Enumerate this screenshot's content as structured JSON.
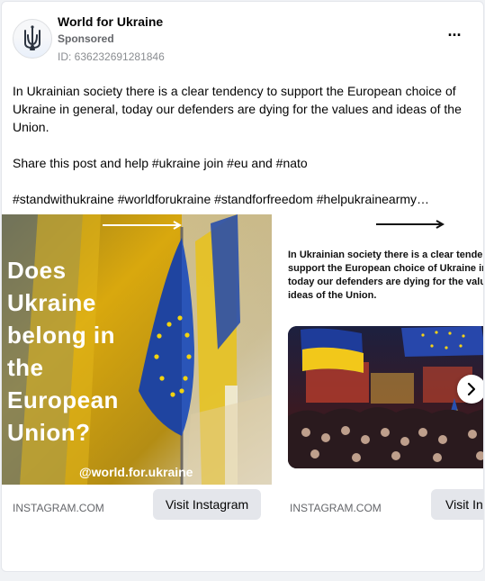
{
  "post": {
    "page_name": "World for Ukraine",
    "sponsored_label": "Sponsored",
    "ad_id": "ID: 636232691281846",
    "more_icon": "more-horizontal-icon",
    "text": {
      "paragraph1": "In Ukrainian society there is a clear tendency to support the European choice of Ukraine in general, today our defenders are dying for the values and ideas of the Union.",
      "paragraph2": "Share this post and help #ukraine join #eu and #nato",
      "paragraph3": "#standwithukraine #worldforukraine #standforfreedom #helpukrainearmy…"
    }
  },
  "carousel": {
    "cards": [
      {
        "image_headline": "Does\nUkraine\nbelong in\nthe\nEuropean\nUnion?",
        "image_handle": "@world.for.ukraine",
        "domain": "INSTAGRAM.COM",
        "button_label": "Visit Instagram"
      },
      {
        "image_text": "In Ukrainian society there is a clear tendency to\nsupport the European choice of Ukraine in general,\ntoday our defenders are dying for the values and\nideas of the Union.",
        "domain": "INSTAGRAM.COM",
        "button_label": "Visit Instagram"
      }
    ],
    "next_icon": "chevron-right-icon"
  },
  "colors": {
    "ukraine_blue": "#0057b7",
    "ukraine_yellow": "#ffd500",
    "secondary_text": "#65676b",
    "button_bg": "#e4e6eb"
  }
}
